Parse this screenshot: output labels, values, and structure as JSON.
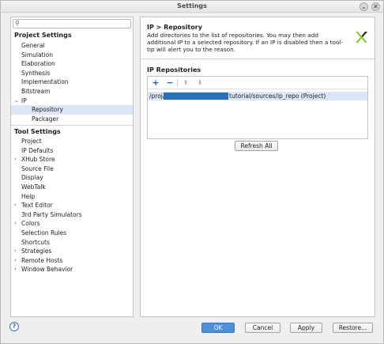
{
  "window": {
    "title": "Settings",
    "minimize_glyph": "⌄",
    "close_glyph": "✕"
  },
  "search": {
    "placeholder": "",
    "value": ""
  },
  "project_settings": {
    "header": "Project Settings",
    "items": [
      {
        "label": "General"
      },
      {
        "label": "Simulation"
      },
      {
        "label": "Elaboration"
      },
      {
        "label": "Synthesis"
      },
      {
        "label": "Implementation"
      },
      {
        "label": "Bitstream"
      },
      {
        "label": "IP"
      }
    ],
    "ip_children": [
      {
        "label": "Repository"
      },
      {
        "label": "Packager"
      }
    ]
  },
  "tool_settings": {
    "header": "Tool Settings",
    "items": [
      {
        "label": "Project"
      },
      {
        "label": "IP Defaults"
      },
      {
        "label": "XHub Store"
      },
      {
        "label": "Source File"
      },
      {
        "label": "Display"
      },
      {
        "label": "WebTalk"
      },
      {
        "label": "Help"
      },
      {
        "label": "Text Editor"
      },
      {
        "label": "3rd Party Simulators"
      },
      {
        "label": "Colors"
      },
      {
        "label": "Selection Rules"
      },
      {
        "label": "Shortcuts"
      },
      {
        "label": "Strategies"
      },
      {
        "label": "Remote Hosts"
      },
      {
        "label": "Window Behavior"
      }
    ]
  },
  "page": {
    "breadcrumb": "IP > Repository",
    "description": "Add directories to the list of repositories. You may then add additional IP to a selected repository. If an IP is disabled then a tool-tip will alert you to the reason.",
    "section_title": "IP Repositories",
    "repos": [
      {
        "prefix": "/proj/",
        "suffix": "tutorial/sources/ip_repo (Project)"
      }
    ],
    "refresh_label": "Refresh All"
  },
  "footer": {
    "help_glyph": "?",
    "ok_label": "OK",
    "cancel_label": "Cancel",
    "apply_label": "Apply",
    "restore_label": "Restore..."
  },
  "colors": {
    "accent": "#4e8fd8",
    "selection": "#dbe6f7",
    "redaction": "#2d6fb8",
    "logo_green": "#8dc63f"
  },
  "icons": {
    "search": "search-icon",
    "add": "plus-icon",
    "remove": "minus-icon",
    "up": "arrow-up-icon",
    "down": "arrow-down-icon",
    "expand": "chevron-right-icon",
    "collapse": "chevron-down-icon"
  }
}
